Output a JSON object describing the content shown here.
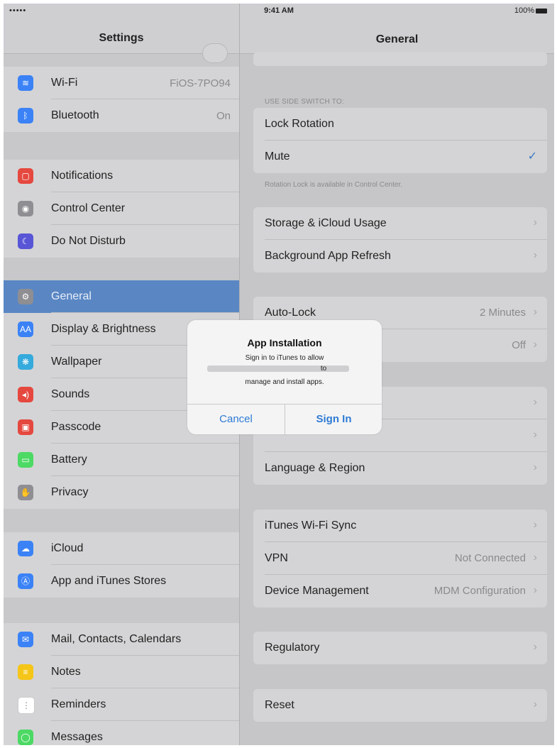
{
  "status_bar": {
    "signal": "•••••",
    "time": "9:41 AM",
    "battery": "100%"
  },
  "left_pane": {
    "title": "Settings",
    "items": [
      {
        "key": "wifi",
        "label": "Wi-Fi",
        "value": "FiOS-7PO94",
        "icon": "wifi-icon",
        "color": "#3b82f6",
        "glyph": "≋"
      },
      {
        "key": "bluetooth",
        "label": "Bluetooth",
        "value": "On",
        "icon": "bluetooth-icon",
        "color": "#3b82f6",
        "glyph": "ᛒ"
      },
      {
        "key": "notifications",
        "label": "Notifications",
        "value": "",
        "icon": "notifications-icon",
        "color": "#e5483f",
        "glyph": "▢"
      },
      {
        "key": "control-center",
        "label": "Control Center",
        "value": "",
        "icon": "control-center-icon",
        "color": "#8e8e93",
        "glyph": "◉"
      },
      {
        "key": "do-not-disturb",
        "label": "Do Not Disturb",
        "value": "",
        "icon": "moon-icon",
        "color": "#5856d6",
        "glyph": "☾"
      },
      {
        "key": "general",
        "label": "General",
        "value": "",
        "icon": "gear-icon",
        "color": "#8e8e93",
        "glyph": "⚙"
      },
      {
        "key": "display",
        "label": "Display & Brightness",
        "value": "",
        "icon": "display-icon",
        "color": "#3b82f6",
        "glyph": "AA"
      },
      {
        "key": "wallpaper",
        "label": "Wallpaper",
        "value": "",
        "icon": "wallpaper-icon",
        "color": "#35aadc",
        "glyph": "❋"
      },
      {
        "key": "sounds",
        "label": "Sounds",
        "value": "",
        "icon": "speaker-icon",
        "color": "#e5483f",
        "glyph": "◂)"
      },
      {
        "key": "passcode",
        "label": "Passcode",
        "value": "",
        "icon": "lock-icon",
        "color": "#e5483f",
        "glyph": "▣"
      },
      {
        "key": "battery",
        "label": "Battery",
        "value": "",
        "icon": "battery-icon",
        "color": "#4cd964",
        "glyph": "▭"
      },
      {
        "key": "privacy",
        "label": "Privacy",
        "value": "",
        "icon": "hand-icon",
        "color": "#8e8e93",
        "glyph": "✋"
      },
      {
        "key": "icloud",
        "label": "iCloud",
        "value": "",
        "icon": "cloud-icon",
        "color": "#3b82f6",
        "glyph": "☁"
      },
      {
        "key": "app-store",
        "label": "App and iTunes Stores",
        "value": "",
        "icon": "app-store-icon",
        "color": "#3b82f6",
        "glyph": "Ⓐ"
      },
      {
        "key": "mail",
        "label": "Mail, Contacts, Calendars",
        "value": "",
        "icon": "mail-icon",
        "color": "#3b82f6",
        "glyph": "✉"
      },
      {
        "key": "notes",
        "label": "Notes",
        "value": "",
        "icon": "notes-icon",
        "color": "#f5c518",
        "glyph": "≡"
      },
      {
        "key": "reminders",
        "label": "Reminders",
        "value": "",
        "icon": "reminders-icon",
        "color": "#ffffff",
        "glyph": "⋮"
      },
      {
        "key": "messages",
        "label": "Messages",
        "value": "",
        "icon": "messages-icon",
        "color": "#4cd964",
        "glyph": "◯"
      }
    ]
  },
  "right_pane": {
    "title": "General",
    "side_switch_header": "USE SIDE SWITCH TO:",
    "side_switch": [
      {
        "label": "Lock Rotation",
        "checked": false
      },
      {
        "label": "Mute",
        "checked": true
      }
    ],
    "side_switch_footer": "Rotation Lock is available in Control Center.",
    "storage_group": [
      {
        "label": "Storage & iCloud Usage",
        "value": ""
      },
      {
        "label": "Background App Refresh",
        "value": ""
      }
    ],
    "lock_group": [
      {
        "label": "Auto-Lock",
        "value": "2 Minutes"
      },
      {
        "label": "",
        "value": "Off"
      }
    ],
    "lang_group": [
      {
        "label": "",
        "value": ""
      },
      {
        "label": "",
        "value": ""
      },
      {
        "label": "Language & Region",
        "value": ""
      }
    ],
    "sync_group": [
      {
        "label": "iTunes Wi-Fi Sync",
        "value": ""
      },
      {
        "label": "VPN",
        "value": "Not Connected"
      },
      {
        "label": "Device Management",
        "value": "MDM Configuration"
      }
    ],
    "regulatory": "Regulatory",
    "reset": "Reset"
  },
  "dialog": {
    "title": "App Installation",
    "line1": "Sign in to iTunes to allow",
    "line2_suffix": "to",
    "line3": "manage and install apps.",
    "cancel": "Cancel",
    "sign_in": "Sign In"
  }
}
